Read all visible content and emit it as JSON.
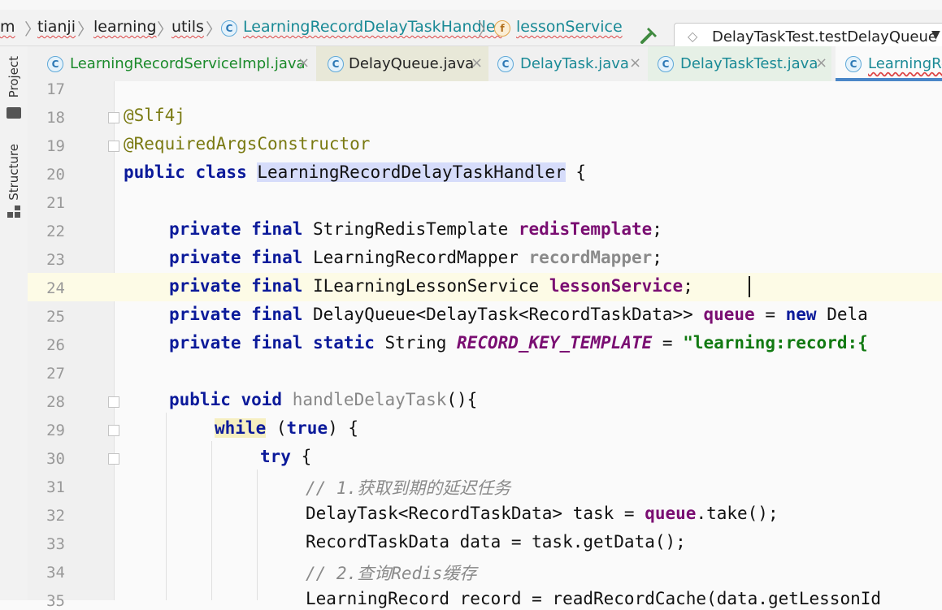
{
  "breadcrumbs": [
    {
      "label": "m"
    },
    {
      "label": "tianji"
    },
    {
      "label": "learning"
    },
    {
      "label": "utils"
    },
    {
      "label": "LearningRecordDelayTaskHandler",
      "badge": "C"
    },
    {
      "label": "lessonService",
      "badge": "f"
    }
  ],
  "run_config": {
    "label": "DelayTaskTest.testDelayQueue"
  },
  "sidebar": {
    "project": "Project",
    "structure": "Structure"
  },
  "tabs": [
    {
      "label": "LearningRecordServiceImpl.java",
      "close": "×"
    },
    {
      "label": "DelayQueue.java",
      "close": "×"
    },
    {
      "label": "DelayTask.java",
      "close": "×"
    },
    {
      "label": "DelayTaskTest.java",
      "close": "×"
    },
    {
      "label": "LearningRe"
    }
  ],
  "line_numbers": [
    "17",
    "18",
    "19",
    "20",
    "21",
    "22",
    "23",
    "24",
    "25",
    "26",
    "27",
    "28",
    "29",
    "30",
    "31",
    "32",
    "33",
    "34",
    "35"
  ],
  "code": {
    "l18": "@Slf4j",
    "l19": "@RequiredArgsConstructor",
    "l20_kw": "public class ",
    "l20_cls": "LearningRecordDelayTaskHandler",
    "l20_rest": " {",
    "l22_kw": "private final ",
    "l22_type": "StringRedisTemplate ",
    "l22_f": "redisTemplate",
    "l22_end": ";",
    "l23_kw": "private final ",
    "l23_type": "LearningRecordMapper ",
    "l23_f": "recordMapper",
    "l23_end": ";",
    "l24_kw": "private final ",
    "l24_type": "ILearningLessonService ",
    "l24_f": "lessonService",
    "l24_end": ";",
    "l25_kw": "private final ",
    "l25_type": "DelayQueue<DelayTask<RecordTaskData>> ",
    "l25_f": "queue",
    "l25_eq": " = ",
    "l25_new": "new ",
    "l25_rest": "Dela",
    "l26_kw": "private final static ",
    "l26_type": "String ",
    "l26_c": "RECORD_KEY_TEMPLATE",
    "l26_eq": " = ",
    "l26_s": "\"learning:record:{",
    "l28_kw": "public void ",
    "l28_m": "handleDelayTask",
    "l28_rest": "(){",
    "l29_kw": "while",
    "l29_sp": " (",
    "l29_true": "true",
    "l29_rest": ") {",
    "l30_kw": "try",
    "l30_rest": " {",
    "l31": "// 1.获取到期的延迟任务",
    "l32_a": "DelayTask<RecordTaskData> task = ",
    "l32_q": "queue",
    "l32_b": ".take();",
    "l33": "RecordTaskData data = task.getData();",
    "l34": "// 2.查询Redis缓存",
    "l35": "LearningRecord record = readRecordCache(data.getLessonId"
  },
  "colors": {
    "keyword": "#0b1a9a",
    "field": "#7a0e72",
    "string": "#127a12",
    "annotation": "#7a7a12",
    "active_tab": "#4a86c8"
  }
}
